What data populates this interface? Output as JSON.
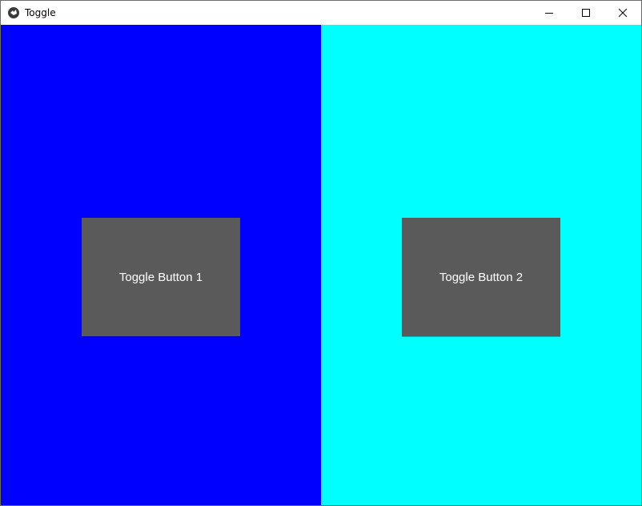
{
  "window": {
    "title": "Toggle",
    "controls": {
      "minimize_icon": "minimize-icon",
      "maximize_icon": "maximize-icon",
      "close_icon": "close-icon"
    }
  },
  "panels": [
    {
      "color": "#0000ff",
      "button": {
        "label": "Toggle Button 1",
        "color": "#5a5a5a"
      }
    },
    {
      "color": "#00ffff",
      "button": {
        "label": "Toggle Button 2",
        "color": "#5a5a5a"
      }
    }
  ]
}
